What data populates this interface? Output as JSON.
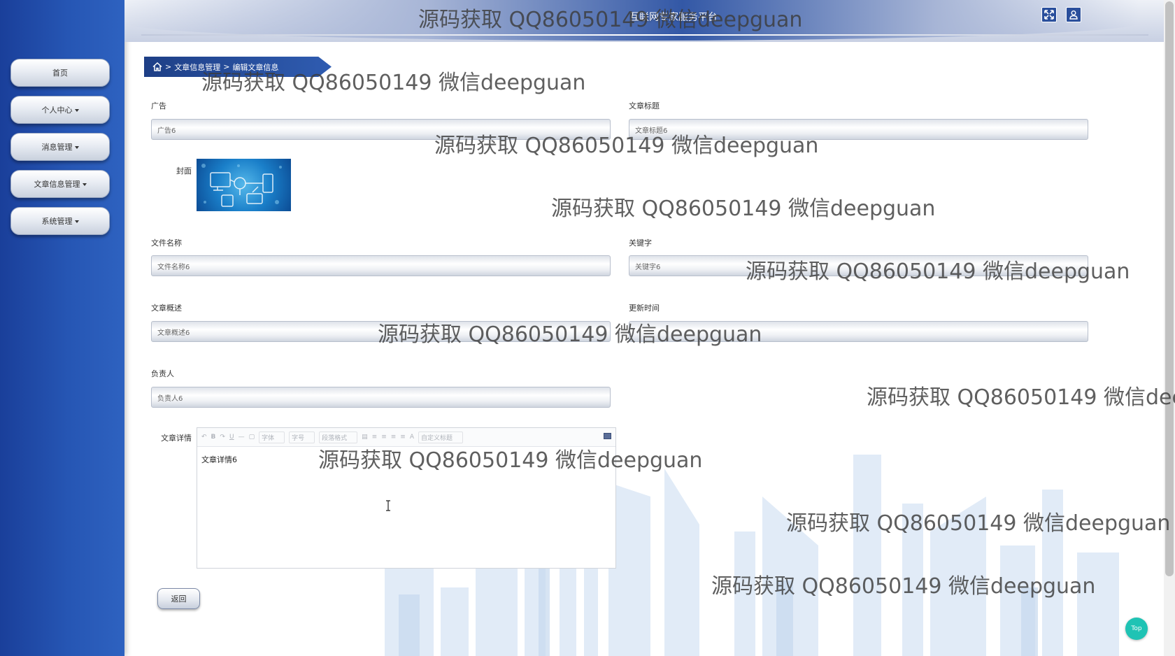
{
  "header": {
    "title": "互联网专家服务平台"
  },
  "sidebar": {
    "items": [
      {
        "label": "首页",
        "dropdown": false
      },
      {
        "label": "个人中心",
        "dropdown": true
      },
      {
        "label": "消息管理",
        "dropdown": true
      },
      {
        "label": "文章信息管理",
        "dropdown": true
      },
      {
        "label": "系统管理",
        "dropdown": true
      }
    ]
  },
  "breadcrumb": {
    "level1": "文章信息管理",
    "level2": "编辑文章信息",
    "separator": ">"
  },
  "form": {
    "ad": {
      "label": "广告",
      "value": "广告6"
    },
    "article_title": {
      "label": "文章标题",
      "value": "文章标题6"
    },
    "cover": {
      "label": "封面"
    },
    "file_name": {
      "label": "文件名称",
      "value": "文件名称6"
    },
    "keyword": {
      "label": "关键字",
      "value": "关键字6"
    },
    "summary": {
      "label": "文章概述",
      "value": "文章概述6"
    },
    "update_time": {
      "label": "更新时间",
      "value": ""
    },
    "owner": {
      "label": "负责人",
      "value": "负责人6"
    },
    "detail": {
      "label": "文章详情",
      "content": "文章详情6",
      "toolbar": {
        "font": "字体",
        "size": "字号",
        "paragraph": "段落格式",
        "custom_title": "自定义标题"
      }
    }
  },
  "buttons": {
    "back": "返回",
    "top": "Top"
  },
  "watermark": "源码获取 QQ86050149 微信deepguan",
  "colors": {
    "sidebar": "#2656b4",
    "breadcrumb": "#1e3f86",
    "top_button": "#1fc3b4"
  }
}
